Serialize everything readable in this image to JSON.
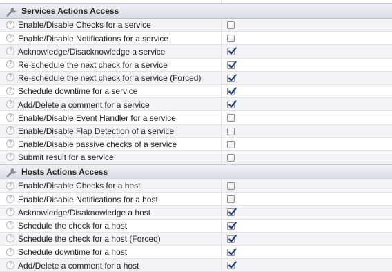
{
  "sections": [
    {
      "title": "Services Actions Access",
      "items": [
        {
          "label": "Enable/Disable Checks for a service",
          "checked": false
        },
        {
          "label": "Enable/Disable Notifications for a service",
          "checked": false
        },
        {
          "label": "Acknowledge/Disacknowledge a service",
          "checked": true
        },
        {
          "label": "Re-schedule the next check for a service",
          "checked": true
        },
        {
          "label": "Re-schedule the next check for a service (Forced)",
          "checked": true
        },
        {
          "label": "Schedule downtime for a service",
          "checked": true
        },
        {
          "label": "Add/Delete a comment for a service",
          "checked": true
        },
        {
          "label": "Enable/Disable Event Handler for a service",
          "checked": false
        },
        {
          "label": "Enable/Disable Flap Detection of a service",
          "checked": false
        },
        {
          "label": "Enable/Disable passive checks of a service",
          "checked": false
        },
        {
          "label": "Submit result for a service",
          "checked": false
        }
      ]
    },
    {
      "title": "Hosts Actions Access",
      "items": [
        {
          "label": "Enable/Disable Checks for a host",
          "checked": false
        },
        {
          "label": "Enable/Disable Notifications for a host",
          "checked": false
        },
        {
          "label": "Acknowledge/Disaknowledge a host",
          "checked": true
        },
        {
          "label": "Schedule the check for a host",
          "checked": true
        },
        {
          "label": "Schedule the check for a host (Forced)",
          "checked": true
        },
        {
          "label": "Schedule downtime for a host",
          "checked": true
        },
        {
          "label": "Add/Delete a comment for a host",
          "checked": true
        }
      ]
    }
  ],
  "icons": {
    "section": "wrench-icon",
    "help": "help-icon"
  },
  "colors": {
    "checkmark": "#1d3f8a",
    "header_bg": "#dde2e8",
    "row_alt_bg": "#f2f4f7"
  }
}
